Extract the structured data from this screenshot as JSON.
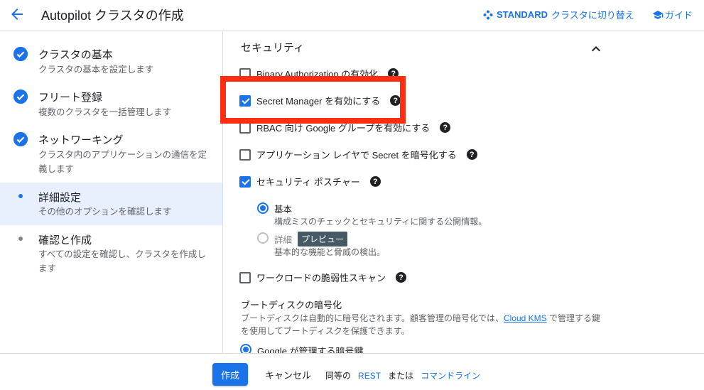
{
  "header": {
    "title": "Autopilot クラスタの作成",
    "standard_bold": "STANDARD",
    "standard_rest": "クラスタに切り替え",
    "guide": "ガイド"
  },
  "stepper": {
    "steps": [
      {
        "title": "クラスタの基本",
        "desc": "クラスタの基本を設定します",
        "state": "done"
      },
      {
        "title": "フリート登録",
        "desc": "複数のクラスタを一括管理します",
        "state": "done"
      },
      {
        "title": "ネットワーキング",
        "desc": "クラスタ内のアプリケーションの通信を定義します",
        "state": "done"
      },
      {
        "title": "詳細設定",
        "desc": "その他のオプションを確認します",
        "state": "current"
      },
      {
        "title": "確認と作成",
        "desc": "すべての設定を確認し、クラスタを作成します",
        "state": "pending"
      }
    ]
  },
  "security": {
    "title": "セキュリティ",
    "options": [
      {
        "label": "Binary Authorization の有効化",
        "checked": false
      },
      {
        "label": "Secret Manager を有効にする",
        "checked": true
      },
      {
        "label": "RBAC 向け Google グループを有効にする",
        "checked": false
      },
      {
        "label": "アプリケーション レイヤで Secret を暗号化する",
        "checked": false
      },
      {
        "label": "セキュリティ ポスチャー",
        "checked": true
      },
      {
        "label": "ワークロードの脆弱性スキャン",
        "checked": false
      }
    ],
    "posture": {
      "basic_label": "基本",
      "basic_desc": "構成ミスのチェックとセキュリティに関する公開情報。",
      "detail_label": "詳細",
      "detail_badge": "プレビュー",
      "detail_desc": "基本的な機能と脅威の検出。"
    },
    "help_glyph": "?"
  },
  "boot_disk": {
    "title": "ブートディスクの暗号化",
    "desc_before": "ブートディスクは自動的に暗号化されます。顧客管理の暗号化では、",
    "link": "Cloud KMS",
    "desc_after": " で管理する鍵を使用してブートディスクを保護できます。",
    "option": "Google が管理する暗号鍵"
  },
  "footer": {
    "create": "作成",
    "cancel": "キャンセル",
    "equiv": "同等の",
    "rest": "REST",
    "or": "または",
    "cli": "コマンドライン"
  },
  "colors": {
    "accent": "#1a73e8",
    "highlight": "#ff2d12"
  }
}
